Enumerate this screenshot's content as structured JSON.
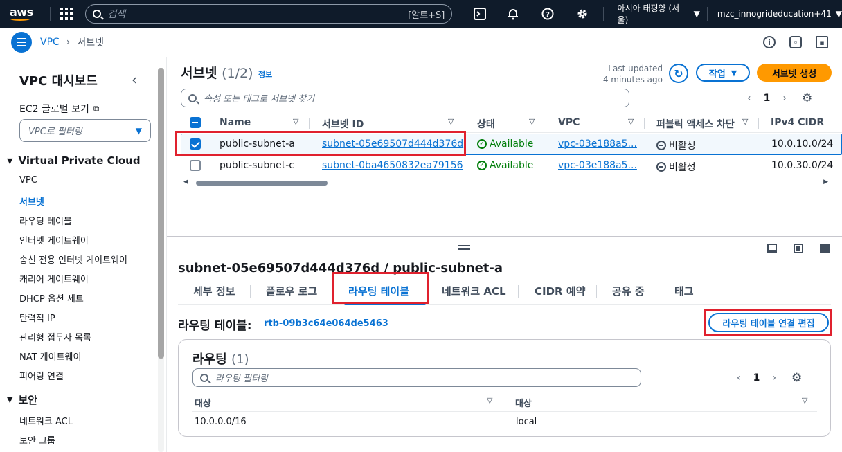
{
  "topnav": {
    "logo": "aws",
    "search_placeholder": "검색",
    "search_shortcut": "[알트+S]",
    "region": "아시아 태평양 (서울)",
    "account": "mzc_innogrideducation+41"
  },
  "breadcrumb": {
    "root": "VPC",
    "current": "서브넷"
  },
  "sidebar": {
    "title": "VPC 대시보드",
    "ec2_global": "EC2 글로벌 보기",
    "filter_placeholder": "VPC로 필터링",
    "section_vpc": "Virtual Private Cloud",
    "items": [
      "VPC",
      "서브넷",
      "라우팅 테이블",
      "인터넷 게이트웨이",
      "송신 전용 인터넷 게이트웨이",
      "캐리어 게이트웨이",
      "DHCP 옵션 세트",
      "탄력적 IP",
      "관리형 접두사 목록",
      "NAT 게이트웨이",
      "피어링 연결"
    ],
    "section_security": "보안",
    "security_items": [
      "네트워크 ACL",
      "보안 그룹"
    ]
  },
  "subnets": {
    "title": "서브넷",
    "count": "(1/2)",
    "info": "정보",
    "last_updated_1": "Last updated",
    "last_updated_2": "4 minutes ago",
    "actions_label": "작업",
    "create_label": "서브넷 생성",
    "search_placeholder": "속성 또는 태그로 서브넷 찾기",
    "page": "1",
    "columns": [
      "Name",
      "서브넷 ID",
      "상태",
      "VPC",
      "퍼블릭 액세스 차단",
      "IPv4 CIDR"
    ],
    "rows": [
      {
        "name": "public-subnet-a",
        "id": "subnet-05e69507d444d376d",
        "status": "Available",
        "vpc": "vpc-03e188a5...",
        "public_block": "비활성",
        "cidr": "10.0.10.0/24",
        "selected": true
      },
      {
        "name": "public-subnet-c",
        "id": "subnet-0ba4650832ea79156",
        "status": "Available",
        "vpc": "vpc-03e188a5...",
        "public_block": "비활성",
        "cidr": "10.0.30.0/24",
        "selected": false
      }
    ]
  },
  "detail": {
    "title": "subnet-05e69507d444d376d / public-subnet-a",
    "tabs": [
      "세부 정보",
      "플로우 로그",
      "라우팅 테이블",
      "네트워크 ACL",
      "CIDR 예약",
      "공유 중",
      "태그"
    ],
    "route_table_label": "라우팅 테이블:",
    "route_table_id": "rtb-09b3c64e064de5463",
    "edit_label": "라우팅 테이블 연결 편집",
    "routes_title": "라우팅",
    "routes_count": "(1)",
    "routes_filter": "라우팅 필터링",
    "routes_page": "1",
    "routes_columns": [
      "대상",
      "대상"
    ],
    "routes_rows": [
      [
        "10.0.0.0/16",
        "local"
      ]
    ]
  },
  "colors": {
    "accent": "#0972d3",
    "primary_button": "#ff9900",
    "nav_bg": "#0f1b2a",
    "highlight": "#e0212e",
    "success": "#037f0c"
  }
}
